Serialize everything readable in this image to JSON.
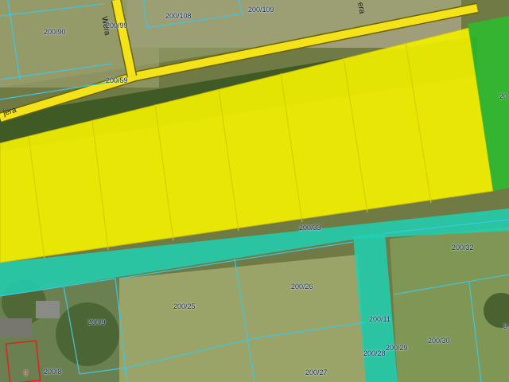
{
  "map": {
    "colors": {
      "road": "#f4e21a",
      "road_outline": "#6a6400",
      "plot_fill": "#f2f000",
      "plot_outline": "#d8c600",
      "parcel_green": "#2fb82f",
      "strip_teal": "#1fd1b4",
      "parcel_lines": "#3fc7e0",
      "building_outline": "#e02020"
    },
    "streets": {
      "vertical": "Wera",
      "horizontal": "jera",
      "top_right": "era"
    },
    "parcels": [
      "200/90",
      "200/99",
      "200/108",
      "200/109",
      "200/59",
      "200/33",
      "200/32",
      "200/26",
      "200/25",
      "200/9",
      "200/11",
      "200/29",
      "200/30",
      "200/28",
      "200/27",
      "200/8"
    ],
    "edge_labels": {
      "green_right": "20",
      "bottom_right": "9",
      "building_letter": "g"
    }
  }
}
